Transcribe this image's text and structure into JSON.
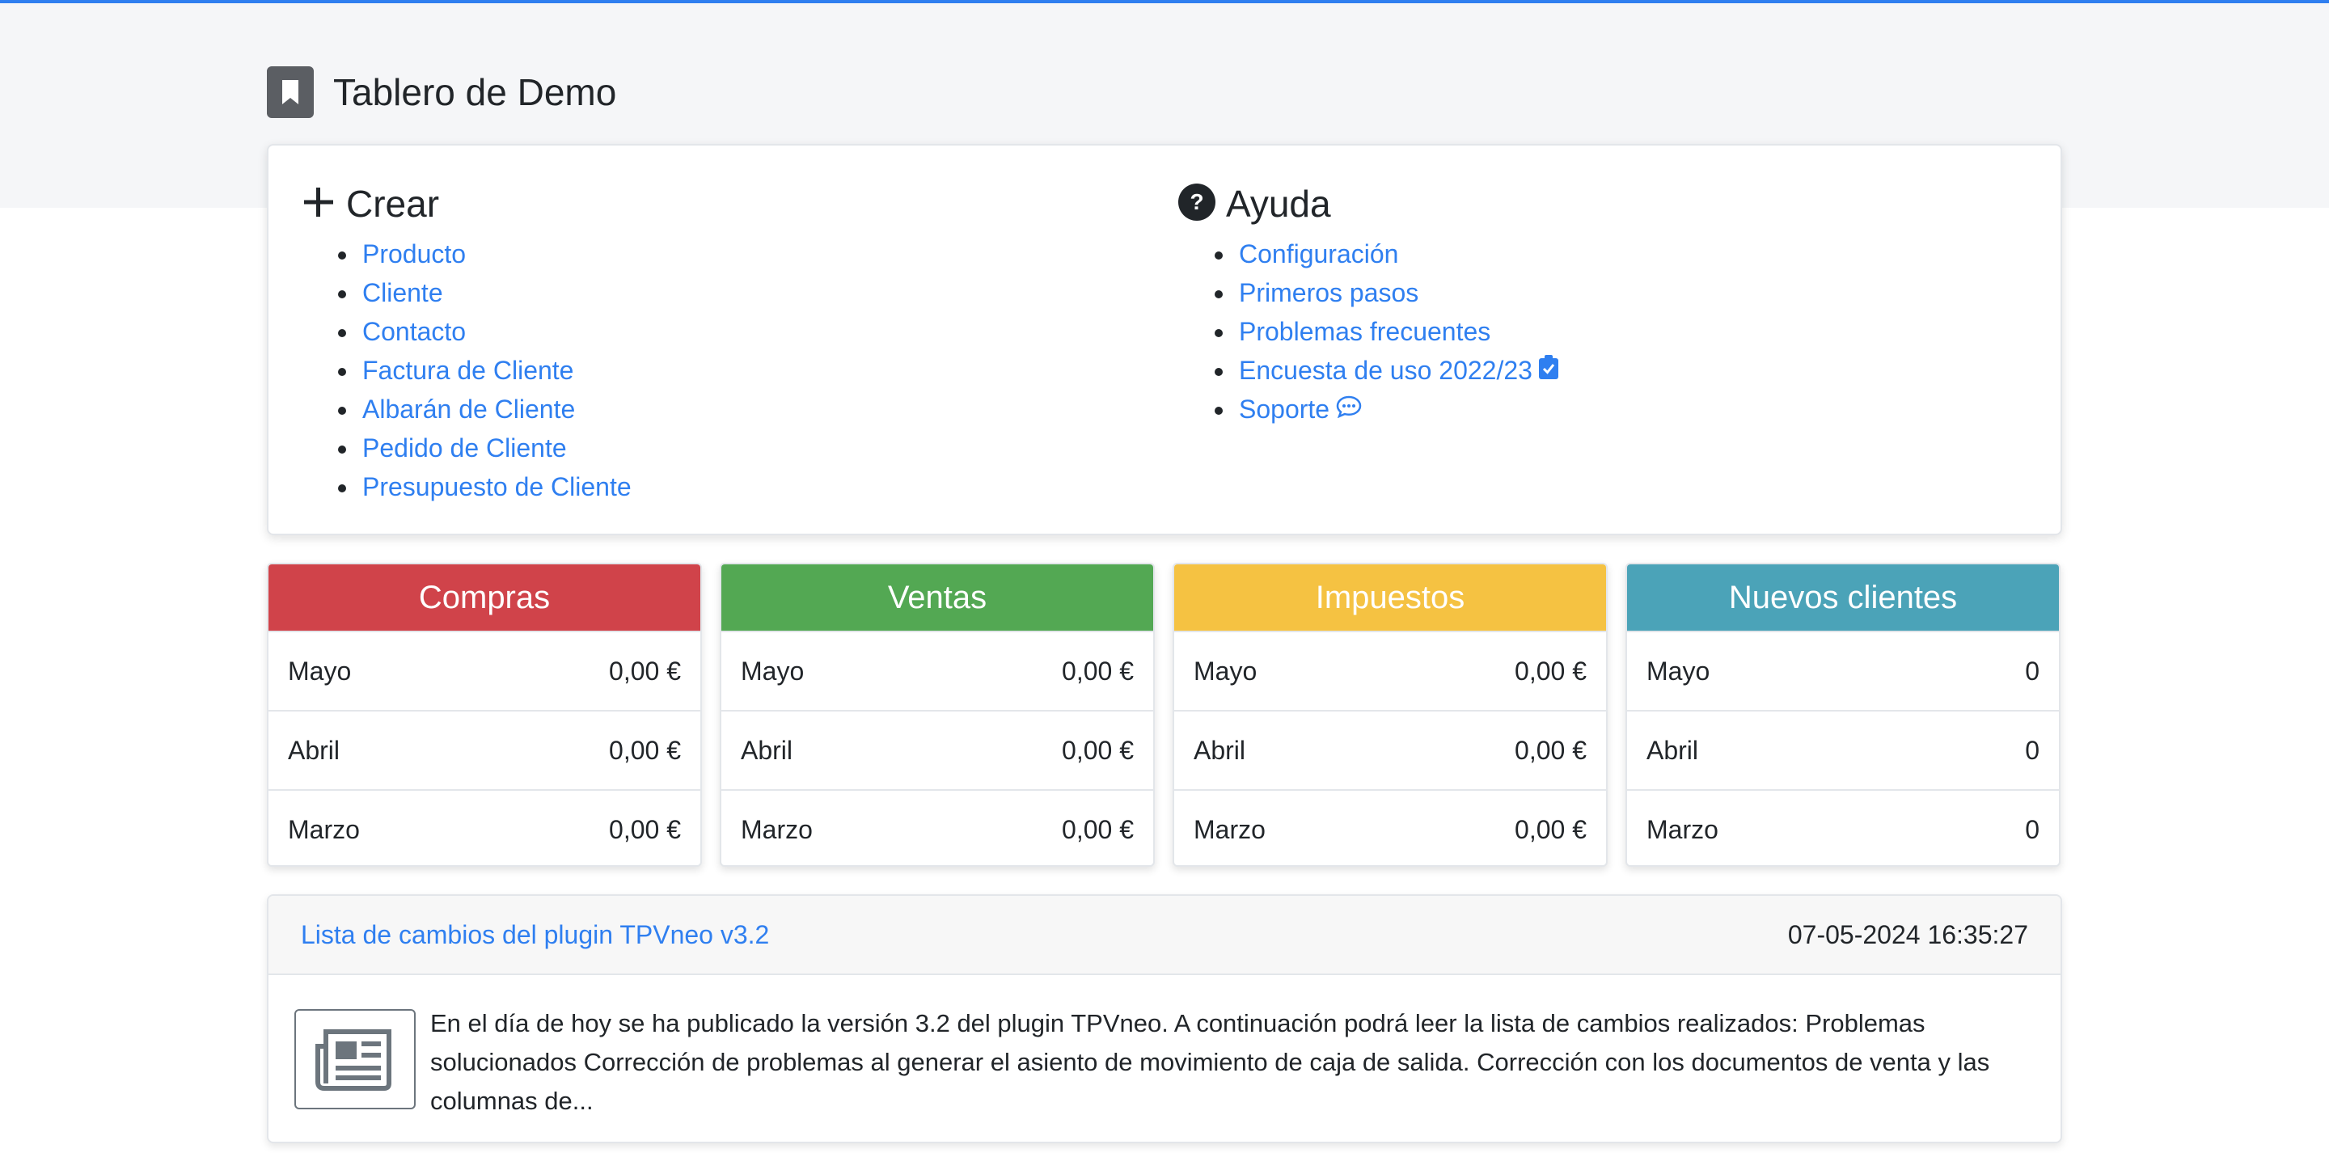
{
  "header": {
    "title": "Tablero de Demo",
    "icon": "bookmark-icon"
  },
  "crear": {
    "title": "Crear",
    "icon": "plus-icon",
    "items": [
      {
        "label": "Producto"
      },
      {
        "label": "Cliente"
      },
      {
        "label": "Contacto"
      },
      {
        "label": "Factura de Cliente"
      },
      {
        "label": "Albarán de Cliente"
      },
      {
        "label": "Pedido de Cliente"
      },
      {
        "label": "Presupuesto de Cliente"
      }
    ]
  },
  "ayuda": {
    "title": "Ayuda",
    "icon": "question-circle-icon",
    "items": [
      {
        "label": "Configuración"
      },
      {
        "label": "Primeros pasos"
      },
      {
        "label": "Problemas frecuentes"
      },
      {
        "label": "Encuesta de uso 2022/23",
        "icon": "clipboard-check-icon"
      },
      {
        "label": "Soporte",
        "icon": "chat-bubble-icon"
      }
    ]
  },
  "stats": [
    {
      "title": "Compras",
      "color": "#d0434a",
      "rows": [
        {
          "month": "Mayo",
          "value": "0,00 €"
        },
        {
          "month": "Abril",
          "value": "0,00 €"
        },
        {
          "month": "Marzo",
          "value": "0,00 €"
        }
      ]
    },
    {
      "title": "Ventas",
      "color": "#53a853",
      "rows": [
        {
          "month": "Mayo",
          "value": "0,00 €"
        },
        {
          "month": "Abril",
          "value": "0,00 €"
        },
        {
          "month": "Marzo",
          "value": "0,00 €"
        }
      ]
    },
    {
      "title": "Impuestos",
      "color": "#f5c242",
      "rows": [
        {
          "month": "Mayo",
          "value": "0,00 €"
        },
        {
          "month": "Abril",
          "value": "0,00 €"
        },
        {
          "month": "Marzo",
          "value": "0,00 €"
        }
      ]
    },
    {
      "title": "Nuevos clientes",
      "color": "#4ba3b8",
      "rows": [
        {
          "month": "Mayo",
          "value": "0"
        },
        {
          "month": "Abril",
          "value": "0"
        },
        {
          "month": "Marzo",
          "value": "0"
        }
      ]
    }
  ],
  "news": {
    "link": "Lista de cambios del plugin TPVneo v3.2",
    "datetime": "07-05-2024 16:35:27",
    "icon": "newspaper-icon",
    "body": "En el día de hoy se ha publicado la versión 3.2 del plugin TPVneo. A continuación podrá leer la lista de cambios realizados: Problemas solucionados Corrección de problemas al generar el asiento de movimiento de caja de salida. Corrección con los documentos de venta y las columnas de..."
  }
}
